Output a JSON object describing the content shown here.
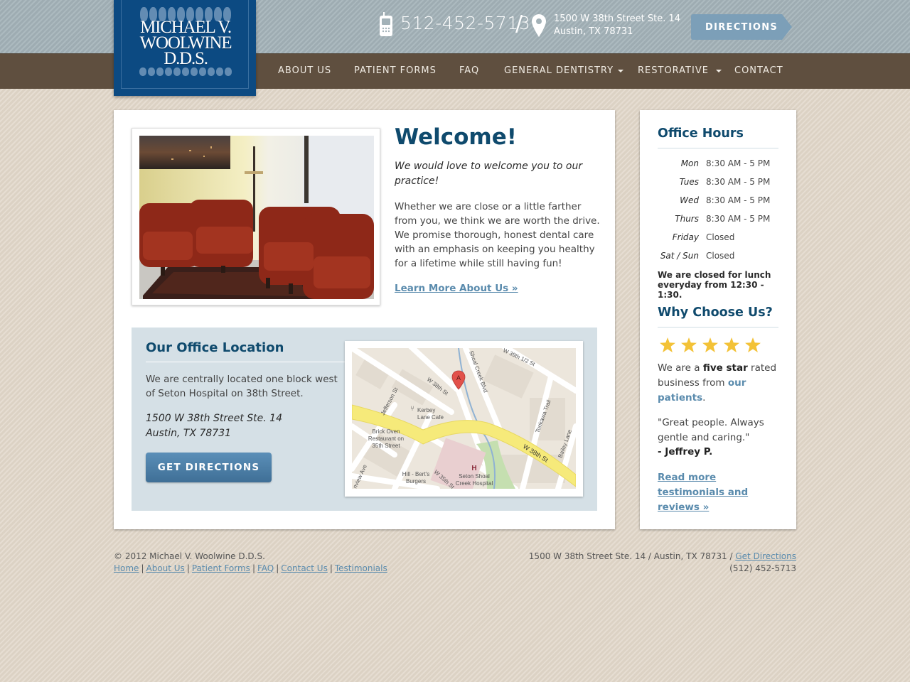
{
  "brand": {
    "logo_lines": [
      "MICHAEL V.",
      "WOOLWINE",
      "D.D.S."
    ],
    "logo_color": "#0c4a82"
  },
  "header": {
    "phone": "512-452-5713",
    "separator": "/",
    "address_line1": "1500 W 38th Street Ste. 14",
    "address_line2": "Austin, TX 78731",
    "directions_label": "DIRECTIONS",
    "icons": {
      "phone": "mobile-phone-icon",
      "location": "map-pin-icon"
    }
  },
  "nav": {
    "items": [
      {
        "label": "ABOUT US",
        "dropdown": false
      },
      {
        "label": "PATIENT FORMS",
        "dropdown": false
      },
      {
        "label": "FAQ",
        "dropdown": false
      },
      {
        "label": "GENERAL DENTISTRY",
        "dropdown": true
      },
      {
        "label": "RESTORATIVE",
        "dropdown": true
      },
      {
        "label": "CONTACT",
        "dropdown": false
      }
    ]
  },
  "welcome": {
    "title": "Welcome!",
    "subtitle": "We would love to welcome you to our practice!",
    "body": "Whether we are close or a little farther from you, we think we are worth the drive. We promise thorough, honest dental care with an emphasis on keeping you healthy for a lifetime while still having fun!",
    "learn_more": "Learn More About Us »",
    "photo_alt": "Waiting room with red armchairs"
  },
  "location": {
    "title": "Our Office Location",
    "body": "We are centrally located one block west of Seton Hospital on 38th Street.",
    "address_line1": "1500 W 38th Street Ste. 14",
    "address_line2": "Austin, TX 78731",
    "button_label": "GET DIRECTIONS",
    "map": {
      "marker_label": "A",
      "streets": [
        "W 39th 1/2 St",
        "Shoal Creek Blvd",
        "W 38th St",
        "Jefferson St",
        "Tonkawa Trail",
        "Bailey Lane",
        "W 38th St",
        "W 35th St",
        "nview Ave",
        "Shoal Creek"
      ],
      "places": [
        "Kerbey Lane Cafe",
        "Brick Oven Restaurant on 35th Street",
        "Hill - Bert's Burgers",
        "Seton Shoal Creek Hospital"
      ],
      "hospital_marker": "H"
    }
  },
  "hours": {
    "title": "Office Hours",
    "rows": [
      {
        "day": "Mon",
        "time": "8:30 AM - 5 PM"
      },
      {
        "day": "Tues",
        "time": "8:30 AM - 5 PM"
      },
      {
        "day": "Wed",
        "time": "8:30 AM - 5 PM"
      },
      {
        "day": "Thurs",
        "time": "8:30 AM - 5 PM"
      },
      {
        "day": "Friday",
        "time": "Closed"
      },
      {
        "day": "Sat / Sun",
        "time": "Closed"
      }
    ],
    "lunch_note": "We are closed for lunch everyday from 12:30 - 1:30."
  },
  "why": {
    "title": "Why Choose Us?",
    "rating": 5,
    "rating_max": 5,
    "star_color": "#f3c237",
    "text_pre": "We are a ",
    "text_bold": "five star",
    "text_mid": " rated business from ",
    "text_link": "our patients",
    "text_post": ".",
    "quote": "\"Great people. Always gentle and caring.\"",
    "quote_author": "- Jeffrey P.",
    "read_more": "Read more testimonials and reviews »"
  },
  "footer": {
    "copyright": "© 2012 Michael V. Woolwine D.D.S.",
    "links": [
      "Home",
      "About Us",
      "Patient Forms",
      "FAQ",
      "Contact Us",
      "Testimonials"
    ],
    "address": "1500 W 38th Street Ste. 14 / Austin, TX 78731 / ",
    "directions_link": "Get Directions",
    "phone": "(512) 452-5713"
  },
  "colors": {
    "heading": "#0f4a6d",
    "link": "#5a8bad",
    "nav_bg": "#5f4f3f",
    "topbar_bg": "#a3b2b8",
    "location_bg": "#d5e0e6",
    "button": "#4a7ea6"
  }
}
